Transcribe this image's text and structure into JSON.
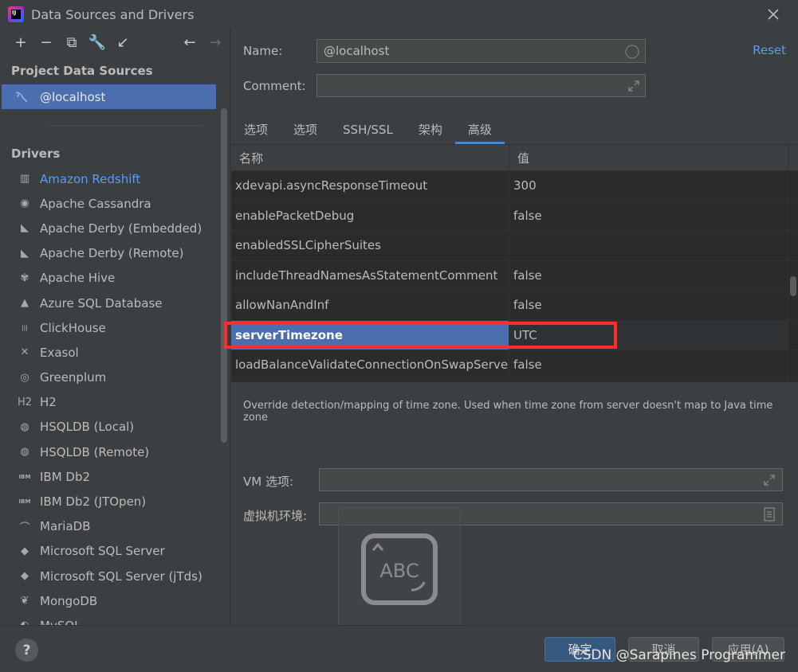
{
  "window": {
    "title": "Data Sources and Drivers",
    "app_icon_text": "IJ"
  },
  "sidebar": {
    "toolbar": [
      {
        "name": "add-icon",
        "glyph": "+"
      },
      {
        "name": "remove-icon",
        "glyph": "−"
      },
      {
        "name": "duplicate-icon",
        "glyph": "⧉"
      },
      {
        "name": "wrench-icon",
        "glyph": "🔧"
      },
      {
        "name": "import-icon",
        "glyph": "↙"
      },
      {
        "name": "back-icon",
        "glyph": "←"
      },
      {
        "name": "forward-icon",
        "glyph": "→"
      }
    ],
    "project_title": "Project Data Sources",
    "data_source": "@localhost",
    "drivers_title": "Drivers",
    "drivers": [
      {
        "label": "Amazon Redshift",
        "icon": "▥",
        "accent": true
      },
      {
        "label": "Apache Cassandra",
        "icon": "◉"
      },
      {
        "label": "Apache Derby (Embedded)",
        "icon": "◣"
      },
      {
        "label": "Apache Derby (Remote)",
        "icon": "◣"
      },
      {
        "label": "Apache Hive",
        "icon": "✾"
      },
      {
        "label": "Azure SQL Database",
        "icon": "▲"
      },
      {
        "label": "ClickHouse",
        "icon": "|||"
      },
      {
        "label": "Exasol",
        "icon": "✕"
      },
      {
        "label": "Greenplum",
        "icon": "◎"
      },
      {
        "label": "H2",
        "icon": "H2"
      },
      {
        "label": "HSQLDB (Local)",
        "icon": "◍"
      },
      {
        "label": "HSQLDB (Remote)",
        "icon": "◍"
      },
      {
        "label": "IBM Db2",
        "icon": "IBM"
      },
      {
        "label": "IBM Db2 (JTOpen)",
        "icon": "IBM"
      },
      {
        "label": "MariaDB",
        "icon": "⌒"
      },
      {
        "label": "Microsoft SQL Server",
        "icon": "◆"
      },
      {
        "label": "Microsoft SQL Server (jTds)",
        "icon": "◆"
      },
      {
        "label": "MongoDB",
        "icon": "❦"
      },
      {
        "label": "MySQL",
        "icon": "◐"
      }
    ]
  },
  "form": {
    "name_label": "Name:",
    "name_value": "@localhost",
    "comment_label": "Comment:",
    "comment_value": "",
    "reset_label": "Reset"
  },
  "tabs": [
    {
      "label": "选项",
      "active": false
    },
    {
      "label": "选项",
      "active": false
    },
    {
      "label": "SSH/SSL",
      "active": false
    },
    {
      "label": "架构",
      "active": false
    },
    {
      "label": "高级",
      "active": true
    }
  ],
  "table": {
    "col_name": "名称",
    "col_value": "值",
    "rows": [
      {
        "name": "xdevapi.asyncResponseTimeout",
        "value": "300"
      },
      {
        "name": "enablePacketDebug",
        "value": "false"
      },
      {
        "name": "enabledSSLCipherSuites",
        "value": ""
      },
      {
        "name": "includeThreadNamesAsStatementComment",
        "value": "false"
      },
      {
        "name": "allowNanAndInf",
        "value": "false"
      },
      {
        "name": "serverTimezone",
        "value": "UTC",
        "selected": true
      },
      {
        "name": "loadBalanceValidateConnectionOnSwapServer",
        "value": "false"
      },
      {
        "name": "",
        "value": ""
      }
    ]
  },
  "description": "Override detection/mapping of time zone. Used when time zone from server doesn't map to Java time zone",
  "vm": {
    "options_label": "VM 选项:",
    "options_value": "",
    "env_label": "虚拟机环境:",
    "env_value": ""
  },
  "overlay_text": "ABC",
  "footer": {
    "help": "?",
    "ok": "确定",
    "cancel": "取消",
    "apply": "应用(A)"
  },
  "watermark": "CSDN @Sarapines Programmer",
  "colors": {
    "background": "#3c3f41",
    "selection": "#4b6eaf",
    "accent_link": "#589df6",
    "highlight_box": "#ff2d2d"
  }
}
